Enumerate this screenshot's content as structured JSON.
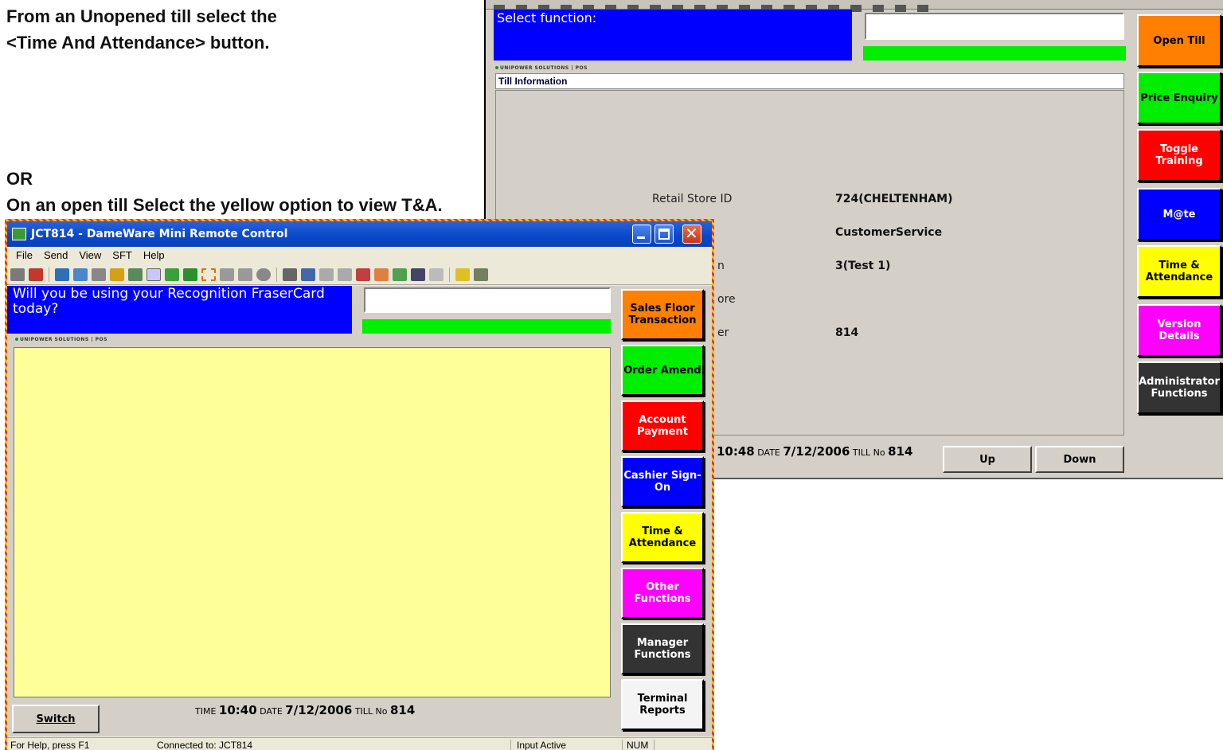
{
  "instructions": {
    "line1": "From an Unopened till select the",
    "line2": "<Time And Attendance> button.",
    "or": "OR",
    "line3": "On an open till  Select the yellow option to view T&A."
  },
  "unopened_till": {
    "prompt": "Select function:",
    "logo": "UNIPOWER SOLUTIONS | POS",
    "section_title": "Till Information",
    "info_rows": [
      {
        "label": "Retail Store ID",
        "value": "724(CHELTENHAM)"
      },
      {
        "label": "",
        "value": "CustomerService"
      },
      {
        "label": "n",
        "value": "3(Test 1)"
      },
      {
        "label": "ore",
        "value": ""
      },
      {
        "label": "er",
        "value": "814"
      }
    ],
    "status": {
      "time": "10:48",
      "date_label": "DATE",
      "date": "7/12/2006",
      "till_label": "TILL No",
      "till": "814"
    },
    "nav_buttons": {
      "up": "Up",
      "down": "Down"
    },
    "function_buttons": [
      {
        "label": "Open Till",
        "color": "#ff8000",
        "text_color": "#000000"
      },
      {
        "label": "Price Enquiry",
        "color": "#00ee00",
        "text_color": "#000000"
      },
      {
        "label": "Toggle Training",
        "color": "#ff0000",
        "text_color": "#ffffff"
      },
      {
        "label": "M@te",
        "color": "#0000ff",
        "text_color": "#ffffff"
      },
      {
        "label": "Time & Attendance",
        "color": "#ffff00",
        "text_color": "#000000"
      },
      {
        "label": "Version Details",
        "color": "#ff00ff",
        "text_color": "#ffffff"
      },
      {
        "label": "Administrator Functions",
        "color": "#333333",
        "text_color": "#ffffff"
      }
    ]
  },
  "dameware": {
    "title": "JCT814 - DameWare Mini Remote Control",
    "menu": [
      "File",
      "Send",
      "View",
      "SFT",
      "Help"
    ],
    "prompt": "Will you be using your Recognition FraserCard today?",
    "logo": "UNIPOWER SOLUTIONS | POS",
    "status": {
      "time_label": "TIME",
      "time": "10:40",
      "date_label": "DATE",
      "date": "7/12/2006",
      "till_label": "TILL No",
      "till": "814"
    },
    "switch_button": "Switch",
    "function_buttons": [
      {
        "label": "Sales Floor Transaction",
        "color": "#ff8000",
        "text_color": "#000000"
      },
      {
        "label": "Order Amend",
        "color": "#00ee00",
        "text_color": "#000000"
      },
      {
        "label": "Account Payment",
        "color": "#ff0000",
        "text_color": "#ffffff"
      },
      {
        "label": "Cashier Sign-On",
        "color": "#0000ff",
        "text_color": "#ffffff"
      },
      {
        "label": "Time & Attendance",
        "color": "#ffff00",
        "text_color": "#000000"
      },
      {
        "label": "Other Functions",
        "color": "#ff00ff",
        "text_color": "#ffffff"
      },
      {
        "label": "Manager Functions",
        "color": "#333333",
        "text_color": "#ffffff"
      },
      {
        "label": "Terminal Reports",
        "color": "#f4f4f4",
        "text_color": "#000000"
      }
    ],
    "statusbar": {
      "help": "For Help, press F1",
      "connected": "Connected to: JCT814",
      "input": "Input Active",
      "num": "NUM"
    }
  }
}
